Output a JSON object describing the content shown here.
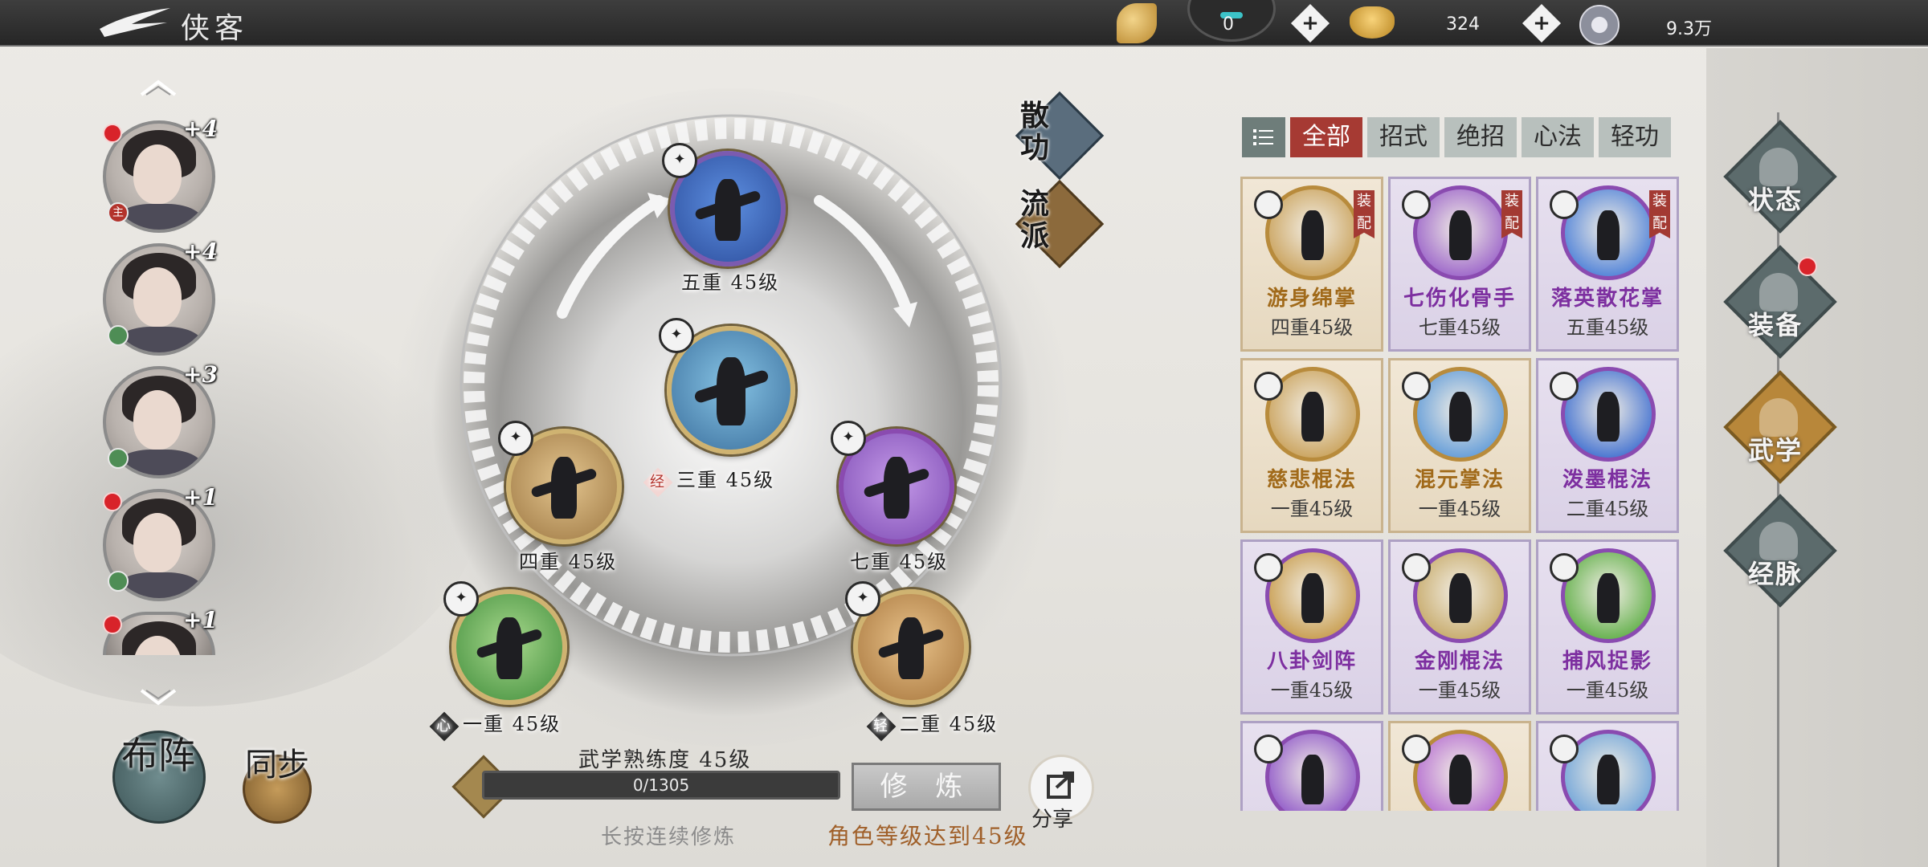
{
  "header": {
    "title": "侠客",
    "resources": [
      {
        "icon": "jade-leaf-icon",
        "value": "0"
      },
      {
        "icon": "gold-ingot-icon",
        "value": "324"
      },
      {
        "icon": "silver-coin-icon",
        "value": "9.3万"
      }
    ]
  },
  "roster": [
    {
      "rank": "+4",
      "tag": "主",
      "red_dot": true
    },
    {
      "rank": "+4",
      "tag": "",
      "red_dot": false
    },
    {
      "rank": "+3",
      "tag": "",
      "red_dot": false
    },
    {
      "rank": "+1",
      "tag": "",
      "red_dot": true
    },
    {
      "rank": "+1",
      "tag": "",
      "red_dot": true
    }
  ],
  "bottom_left": {
    "formation": "布阵",
    "sync": "同步"
  },
  "wheel": {
    "side_buttons": [
      "散功",
      "流派"
    ],
    "nodes": [
      {
        "id": "top",
        "level": "五重 45级",
        "tag": ""
      },
      {
        "id": "center",
        "level": "三重 45级",
        "tag": "经"
      },
      {
        "id": "left",
        "level": "四重 45级",
        "tag": ""
      },
      {
        "id": "right",
        "level": "七重 45级",
        "tag": ""
      },
      {
        "id": "bottom-left",
        "level": "一重 45级",
        "tag": "心"
      },
      {
        "id": "bottom-right",
        "level": "二重 45级",
        "tag": "轻"
      }
    ]
  },
  "progress": {
    "title": "武学熟练度 45级",
    "value_text": "0/1305",
    "fraction": 0.0,
    "train_label": "修 炼",
    "hint": "长按连续修炼",
    "requirement": "角色等级达到45级",
    "share_label": "分享"
  },
  "filters": {
    "tabs": [
      "全部",
      "招式",
      "绝招",
      "心法",
      "轻功"
    ],
    "active": 0
  },
  "skills": [
    {
      "name": "游身绵掌",
      "level": "四重45级",
      "equipped": "装配",
      "style": "gold",
      "color": "#c9a15a"
    },
    {
      "name": "七伤化骨手",
      "level": "七重45级",
      "equipped": "装配",
      "style": "purple",
      "color": "#9a62c9"
    },
    {
      "name": "落英散花掌",
      "level": "五重45级",
      "equipped": "装配",
      "style": "purple",
      "color": "#4b7fd8"
    },
    {
      "name": "慈悲棍法",
      "level": "一重45级",
      "equipped": "",
      "style": "gold",
      "color": "#c9a15a"
    },
    {
      "name": "混元掌法",
      "level": "一重45级",
      "equipped": "",
      "style": "gold",
      "color": "#5f9ad8"
    },
    {
      "name": "泼墨棍法",
      "level": "二重45级",
      "equipped": "",
      "style": "purple",
      "color": "#3f6fd0"
    },
    {
      "name": "八卦剑阵",
      "level": "一重45级",
      "equipped": "",
      "style": "purple",
      "color": "#c79b4b"
    },
    {
      "name": "金刚棍法",
      "level": "一重45级",
      "equipped": "",
      "style": "purple",
      "color": "#c6a968"
    },
    {
      "name": "捕风捉影",
      "level": "一重45级",
      "equipped": "",
      "style": "purple",
      "color": "#5fae47"
    },
    {
      "name": "",
      "level": "",
      "equipped": "",
      "style": "purple",
      "color": "#8e56c8"
    },
    {
      "name": "",
      "level": "",
      "equipped": "",
      "style": "gold",
      "color": "#b36ad0"
    },
    {
      "name": "",
      "level": "",
      "equipped": "",
      "style": "purple",
      "color": "#6ea3d8"
    }
  ],
  "side_nav": [
    {
      "label": "状态",
      "icon": "status-figure-icon",
      "active": false,
      "red_dot": false
    },
    {
      "label": "装备",
      "icon": "sword-icon",
      "active": false,
      "red_dot": true
    },
    {
      "label": "武学",
      "icon": "scroll-icon",
      "active": true,
      "red_dot": false
    },
    {
      "label": "经脉",
      "icon": "meditation-icon",
      "active": false,
      "red_dot": false
    }
  ]
}
